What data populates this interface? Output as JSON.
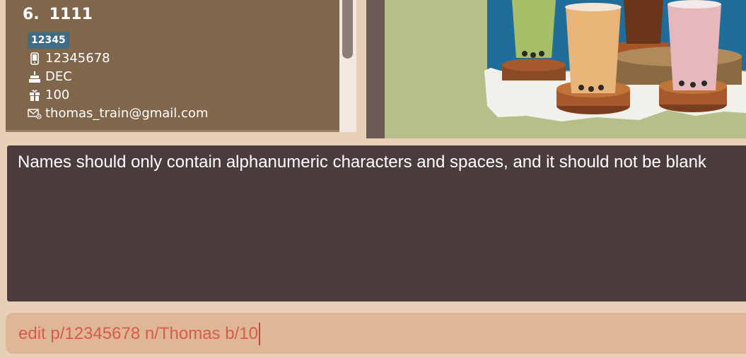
{
  "person_card": {
    "index": "6.",
    "name": "1111",
    "tag": "12345",
    "phone": "12345678",
    "birthday": "DEC",
    "points": "100",
    "email": "thomas_train@gmail.com"
  },
  "result_display": {
    "message": "Names should only contain alphanumeric characters and spaces, and it should not be blank"
  },
  "command_box": {
    "input_value": "edit p/12345678 n/Thomas b/10"
  },
  "colors": {
    "card_background": "#80664b",
    "tag_background": "#3f6c84",
    "result_background": "#4b3c3e",
    "command_background": "#dfb797",
    "command_text": "#d55b4d"
  },
  "icons": {
    "phone": "phone-icon",
    "birthday": "cake-icon",
    "points": "gift-icon",
    "email": "email-icon"
  }
}
